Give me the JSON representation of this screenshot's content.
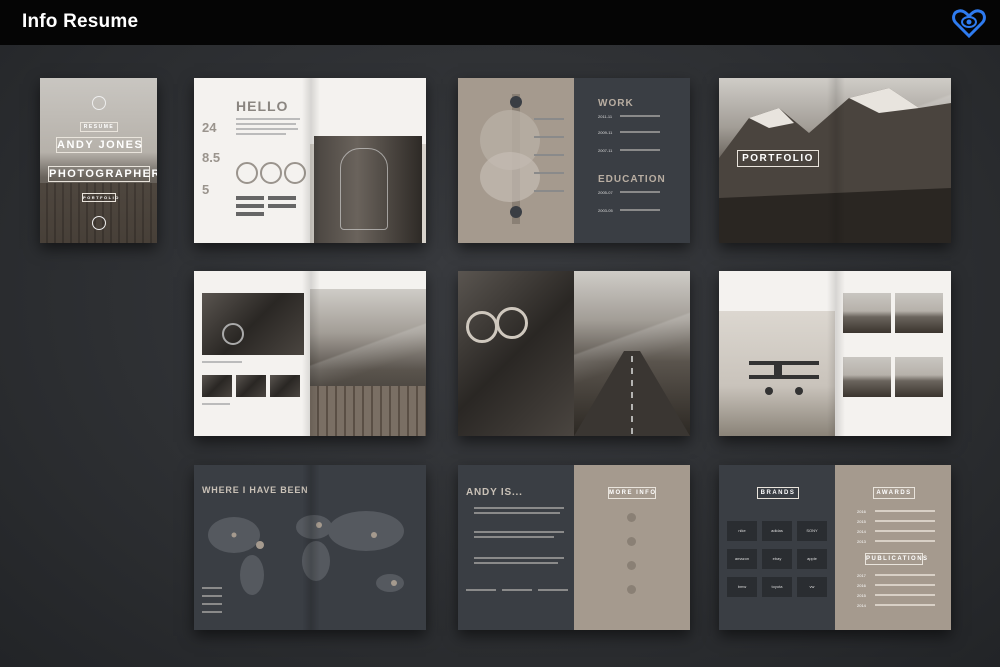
{
  "header": {
    "title": "Info Resume",
    "logo_icon": "heart-eye-logo-icon",
    "logo_color": "#2e7bf0"
  },
  "cover": {
    "resume": "RESUME",
    "name": "ANDY JONES",
    "role": "PHOTOGRAPHER",
    "portfolio": "PORTFOLIO"
  },
  "hello": {
    "heading": "HELLO",
    "stats": [
      "24",
      "8.5",
      "5"
    ]
  },
  "experience": {
    "work": "WORK",
    "education": "EDUCATION",
    "years": [
      "2011-11",
      "2009-11",
      "2007-11"
    ],
    "edu_years": [
      "2005-07",
      "2003-05"
    ]
  },
  "portfolio_spread": {
    "title": "PORTFOLIO"
  },
  "places": {
    "title": "WHERE I HAVE BEEN"
  },
  "about": {
    "title": "ANDY IS...",
    "more_info": "MORE INFO"
  },
  "brands": {
    "title": "BRANDS",
    "awards": "AWARDS",
    "publications": "PUBLICATIONS",
    "logos": [
      "nike",
      "adidas",
      "SONY",
      "amazon",
      "ebay",
      "apple",
      "bmw",
      "toyota",
      "vw"
    ],
    "award_years": [
      "2016",
      "2015",
      "2014",
      "2013"
    ],
    "pub_years": [
      "2017",
      "2016",
      "2015",
      "2014"
    ]
  },
  "colors": {
    "background": "#2b2d30",
    "topbar": "#050505",
    "taupe": "#a59a8e",
    "slate": "#3a3e44"
  }
}
